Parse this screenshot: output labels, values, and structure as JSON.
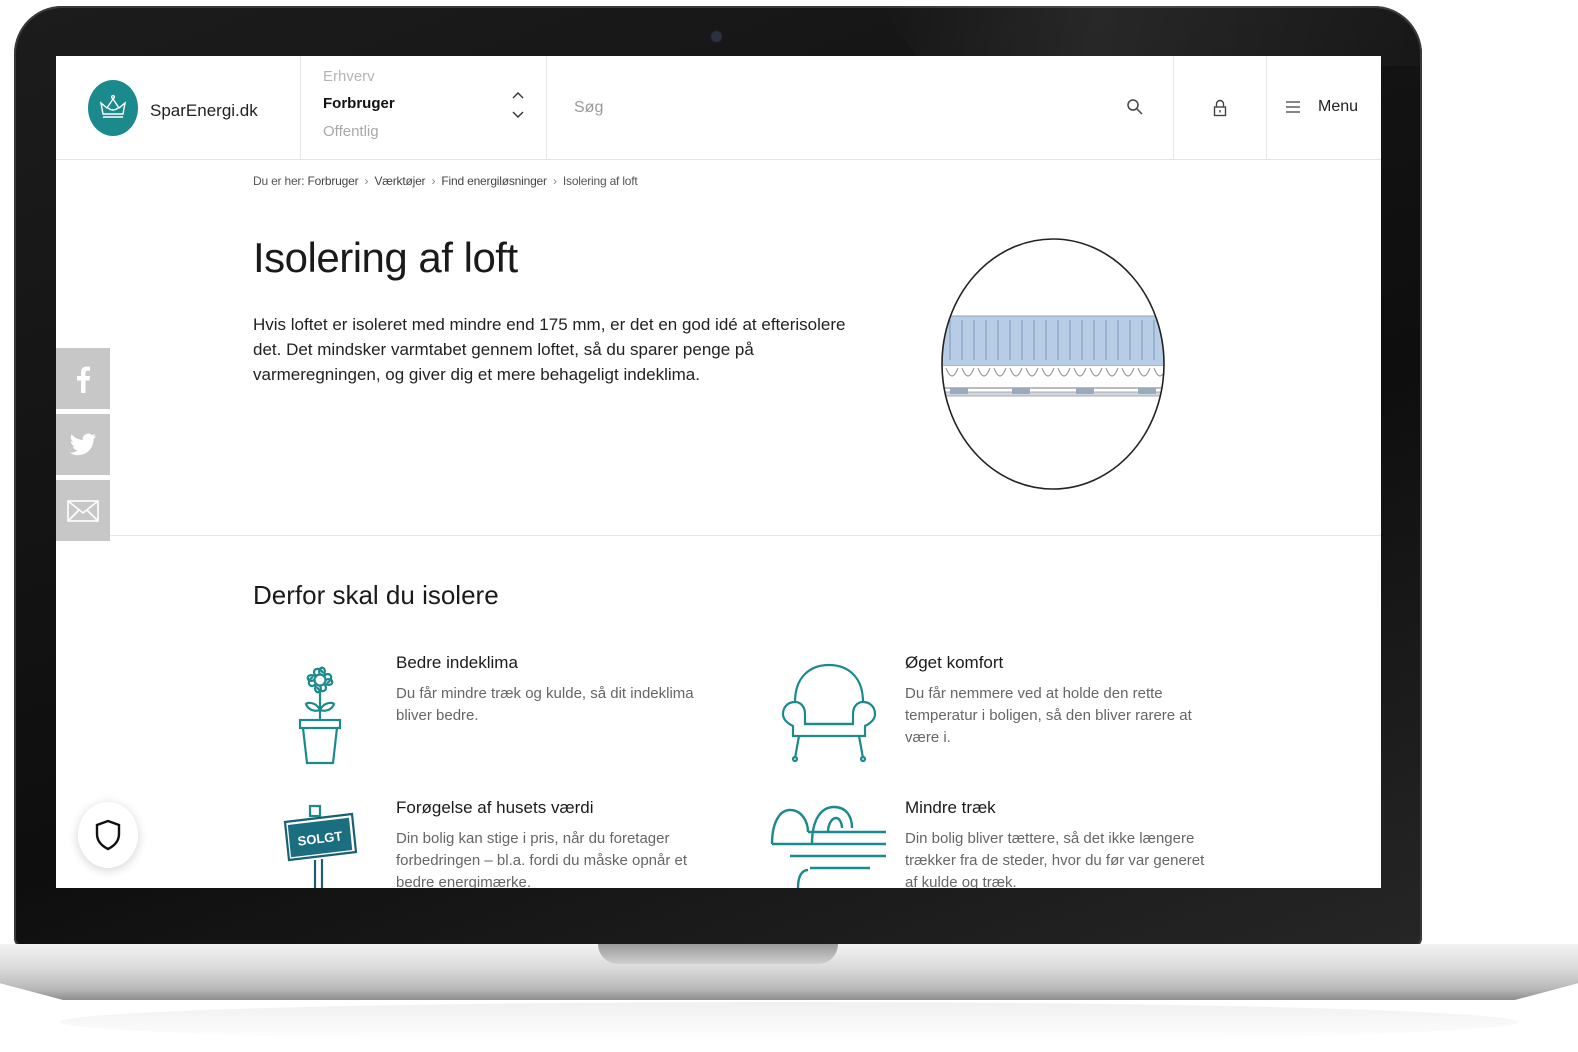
{
  "site": {
    "logo_text": "SparEnergi.dk"
  },
  "sector_switch": {
    "items": [
      "Erhverv",
      "Forbruger",
      "Offentlig"
    ],
    "selected": "Forbruger"
  },
  "search": {
    "placeholder": "Søg"
  },
  "menu": {
    "label": "Menu"
  },
  "breadcrumb": {
    "prefix": "Du er her:",
    "items": [
      "Forbruger",
      "Værktøjer",
      "Find energiløsninger",
      "Isolering af loft"
    ]
  },
  "hero": {
    "title": "Isolering af loft",
    "text": "Hvis loftet er isoleret med mindre end 175 mm, er det en god idé at efterisolere det. Det mindsker varmtabet gennem loftet, så du sparer penge på varmeregningen, og giver dig et mere behageligt indeklima."
  },
  "section": {
    "title": "Derfor skal du isolere",
    "features": [
      {
        "icon": "flower-pot-icon",
        "title": "Bedre indeklima",
        "desc": "Du får mindre træk og kulde, så dit indeklima bliver bedre."
      },
      {
        "icon": "armchair-icon",
        "title": "Øget komfort",
        "desc": "Du får nemmere ved at holde den rette temperatur i boligen, så den bliver rarere at være i."
      },
      {
        "icon": "sold-sign-icon",
        "sign_text": "SOLGT",
        "title": "Forøgelse af husets værdi",
        "desc": "Din bolig kan stige i pris, når du foretager forbedringen – bl.a. fordi du måske opnår et bedre energimærke."
      },
      {
        "icon": "wind-icon",
        "title": "Mindre træk",
        "desc": "Din bolig bliver tættere, så det ikke længere trækker fra de steder, hvor du før var generet af kulde og træk."
      }
    ]
  },
  "social": [
    "facebook-icon",
    "twitter-icon",
    "email-icon"
  ],
  "colors": {
    "brand": "#1a8a8c",
    "icon_teal": "#1a8a8c",
    "insulation": "#b7cde6",
    "social_bg": "#c7c7c7"
  }
}
